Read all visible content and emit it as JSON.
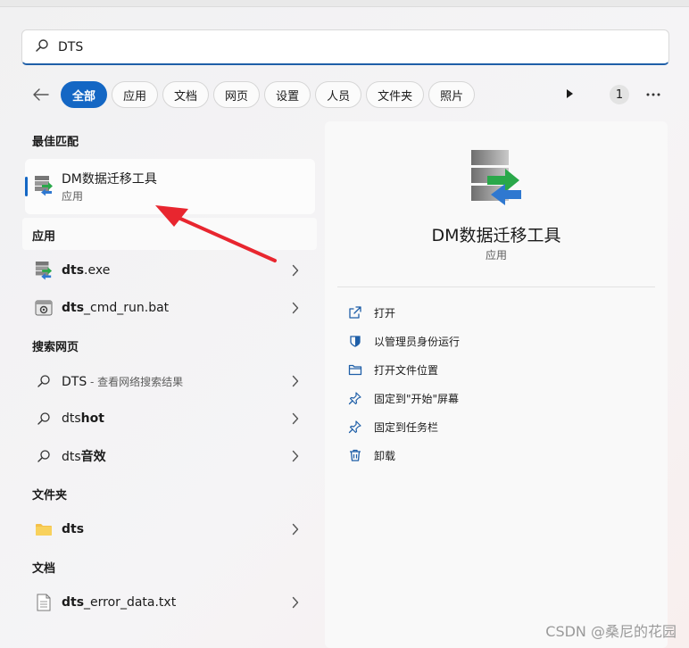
{
  "search": {
    "value": "DTS"
  },
  "filters": [
    "全部",
    "应用",
    "文档",
    "网页",
    "设置",
    "人员",
    "文件夹",
    "照片"
  ],
  "filter_count": "1",
  "best_match": {
    "title": "最佳匹配",
    "name": "DM数据迁移工具",
    "type": "应用"
  },
  "apps": {
    "title": "应用",
    "items": [
      {
        "bold": "dts",
        "rest": ".exe"
      },
      {
        "bold": "dts",
        "rest": "_cmd_run.bat"
      }
    ]
  },
  "web": {
    "title": "搜索网页",
    "items": [
      {
        "main": "DTS",
        "sub": " - 查看网络搜索结果"
      },
      {
        "plain": "dts",
        "bold": "hot"
      },
      {
        "plain": "dts",
        "bold": "音效"
      }
    ]
  },
  "folders": {
    "title": "文件夹",
    "items": [
      {
        "bold": "dts"
      }
    ]
  },
  "docs": {
    "title": "文档",
    "items": [
      {
        "bold": "dts",
        "rest": "_error_data.txt"
      }
    ]
  },
  "detail": {
    "name": "DM数据迁移工具",
    "type": "应用",
    "actions": [
      "打开",
      "以管理员身份运行",
      "打开文件位置",
      "固定到\"开始\"屏幕",
      "固定到任务栏",
      "卸载"
    ]
  },
  "watermark": "CSDN @桑尼的花园",
  "colors": {
    "accent": "#1467c4",
    "arrow": "#e8262f",
    "app_green": "#2aa84a",
    "app_blue": "#2f78d0"
  }
}
